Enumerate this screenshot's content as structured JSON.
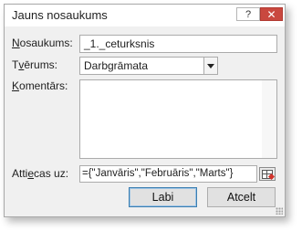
{
  "dialog": {
    "title": "Jauns nosaukums",
    "help_label": "?",
    "close_label": "✕"
  },
  "fields": {
    "name": {
      "label_underlined": "N",
      "label_rest": "osaukums:",
      "value": "_1._ceturksnis"
    },
    "scope": {
      "label_pre": "T",
      "label_underlined": "v",
      "label_rest": "ērums:",
      "value": "Darbgrāmata"
    },
    "comment": {
      "label_underlined": "K",
      "label_rest": "omentārs:",
      "value": ""
    },
    "refers_to": {
      "label_pre": "Atti",
      "label_underlined": "e",
      "label_rest": "cas uz:",
      "value": "={\"Janvāris\",\"Februāris\",\"Marts\"}"
    }
  },
  "buttons": {
    "ok": "Labi",
    "cancel": "Atcelt"
  },
  "icons": {
    "dropdown": "chevron-down-icon",
    "range_picker": "range-select-icon",
    "resize": "resize-grip-icon"
  }
}
